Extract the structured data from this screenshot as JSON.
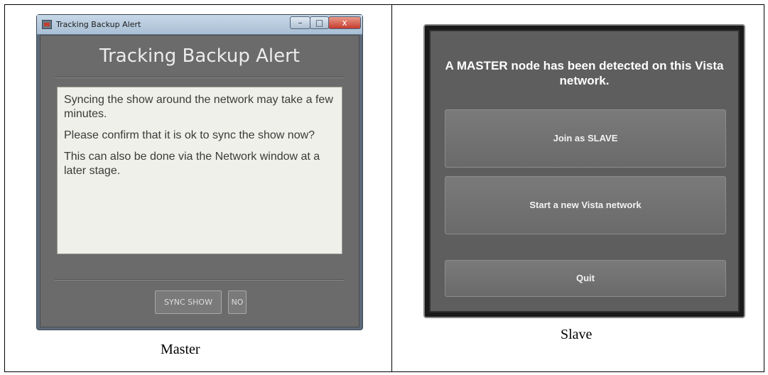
{
  "master": {
    "window_title": "Tracking Backup Alert",
    "heading": "Tracking Backup Alert",
    "paragraphs": [
      "Syncing the show around the network may take a few minutes.",
      "Please confirm that it is ok to sync the show now?",
      "This can also be done via the Network window at a later stage."
    ],
    "buttons": {
      "sync": "SYNC SHOW",
      "no": "NO"
    },
    "window_controls": {
      "minimize": "–",
      "maximize": "□",
      "close": "x"
    },
    "caption": "Master"
  },
  "slave": {
    "heading": "A MASTER node has been detected on this Vista network.",
    "buttons": {
      "join": "Join as SLAVE",
      "new_network": "Start a new Vista network",
      "quit": "Quit"
    },
    "caption": "Slave"
  }
}
